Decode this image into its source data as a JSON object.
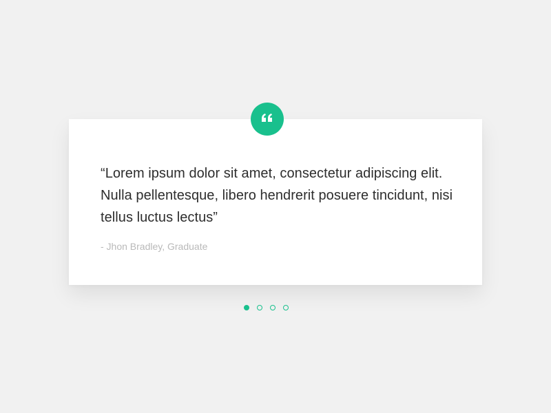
{
  "testimonial": {
    "quote": "“Lorem ipsum dolor sit amet, consectetur adipiscing elit. Nulla pellentesque, libero hendrerit posuere tincidunt, nisi tellus luctus lectus”",
    "author": "- Jhon Bradley, Graduate"
  },
  "badge": {
    "icon": "quote-icon",
    "color": "#19c08d"
  },
  "pagination": {
    "count": 4,
    "active_index": 0,
    "color": "#19c08d"
  }
}
